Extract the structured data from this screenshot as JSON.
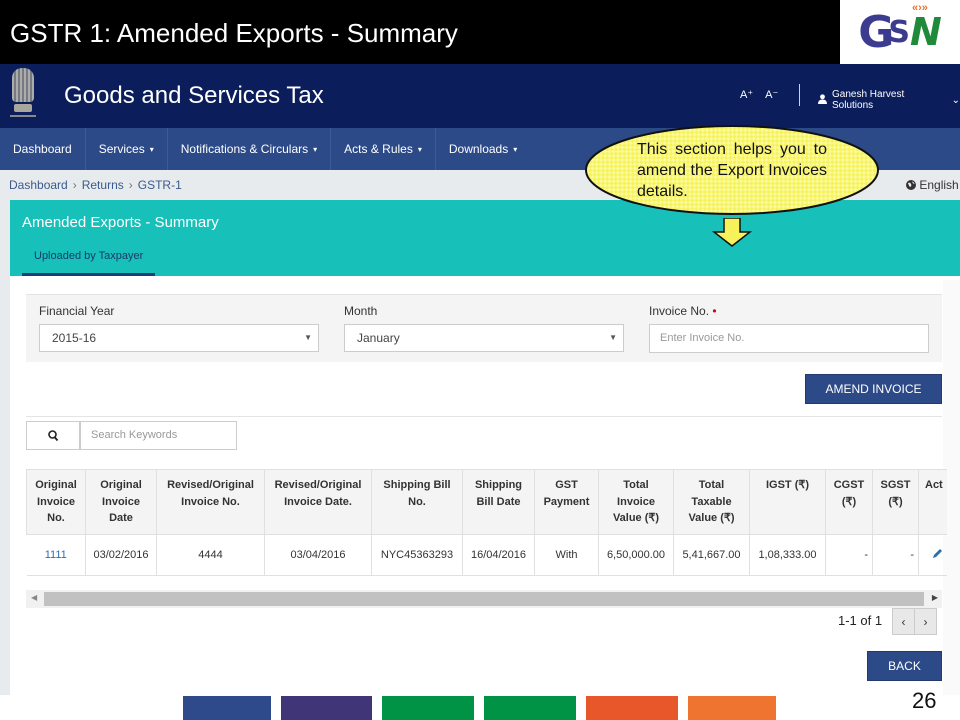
{
  "slide": {
    "title": "GSTR 1: Amended Exports - Summary",
    "page_number": "26",
    "logo": {
      "letters_g": "G",
      "letters_s": "S",
      "letters_n": "N",
      "arrows": "«›»"
    },
    "color_strip": [
      "#2e4a8a",
      "#3f3577",
      "#009245",
      "#009245",
      "#e8572a",
      "#ee7430"
    ]
  },
  "header": {
    "site_title": "Goods and Services Tax",
    "font_increase": "A⁺",
    "font_decrease": "A⁻",
    "user_icon": "👤",
    "user_name": "Ganesh Harvest Solutions",
    "user_caret": "⌄"
  },
  "nav": {
    "items": [
      {
        "label": "Dashboard",
        "has_caret": false
      },
      {
        "label": "Services",
        "has_caret": true
      },
      {
        "label": "Notifications & Circulars",
        "has_caret": true
      },
      {
        "label": "Acts & Rules",
        "has_caret": true
      },
      {
        "label": "Downloads",
        "has_caret": true
      }
    ],
    "caret": "▾"
  },
  "breadcrumb": {
    "items": [
      "Dashboard",
      "Returns",
      "GSTR-1"
    ],
    "separator": "›"
  },
  "language": {
    "icon": "🌐",
    "label": "English"
  },
  "panel": {
    "title": "Amended Exports - Summary",
    "tab": "Uploaded by Taxpayer"
  },
  "filters": {
    "financial_year": {
      "label": "Financial Year",
      "value": "2015-16"
    },
    "month": {
      "label": "Month",
      "value": "January"
    },
    "invoice_no": {
      "label": "Invoice No.",
      "required_marker": "•",
      "placeholder": "Enter Invoice No.",
      "value": ""
    },
    "dropdown_arrow": "▼"
  },
  "buttons": {
    "amend_invoice": "AMEND INVOICE",
    "back": "BACK"
  },
  "search": {
    "icon": "🔍",
    "placeholder": "Search Keywords"
  },
  "table": {
    "headers": [
      "Original Invoice No.",
      "Original Invoice Date",
      "Revised/Original Invoice No.",
      "Revised/Original Invoice Date.",
      "Shipping Bill No.",
      "Shipping Bill Date",
      "GST Payment",
      "Total Invoice Value (₹)",
      "Total Taxable Value (₹)",
      "IGST (₹)",
      "CGST (₹)",
      "SGST (₹)",
      "Act"
    ],
    "rows": [
      {
        "original_invoice_no": "1111",
        "original_invoice_date": "03/02/2016",
        "revised_invoice_no": "4444",
        "revised_invoice_date": "03/04/2016",
        "shipping_bill_no": "NYC45363293",
        "shipping_bill_date": "16/04/2016",
        "gst_payment": "With",
        "total_invoice_value": "6,50,000.00",
        "total_taxable_value": "5,41,667.00",
        "igst": "1,08,333.00",
        "cgst": "-",
        "sgst": "-",
        "action_icon": "✎"
      }
    ]
  },
  "pagination": {
    "summary": "1-1 of 1",
    "prev": "‹",
    "next": "›"
  },
  "scrollbar": {
    "left_arrow": "◀",
    "right_arrow": "▶"
  },
  "callout": {
    "text": "This section helps you to amend the Export Invoices details."
  }
}
